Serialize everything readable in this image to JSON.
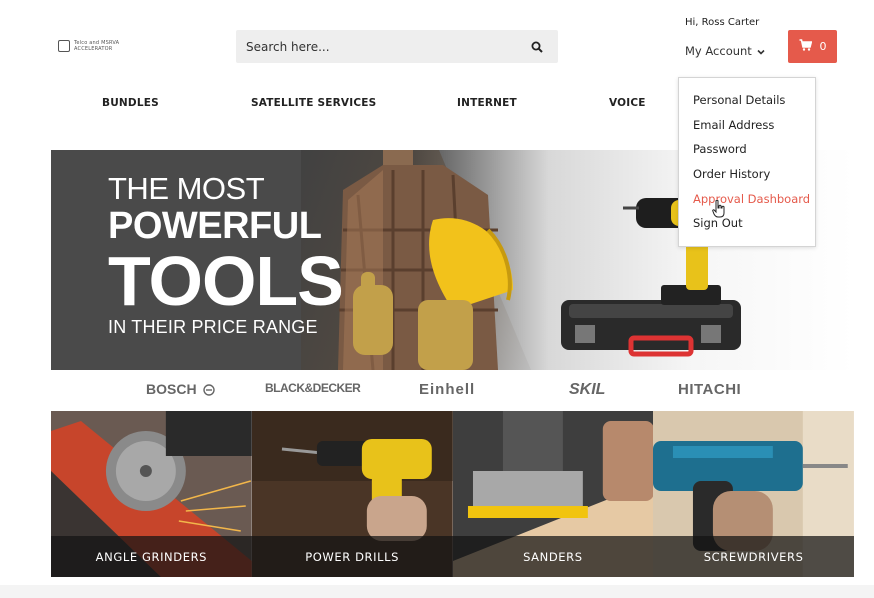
{
  "header": {
    "logo_text": "Telco and MSRVA ACCELERATOR",
    "search_placeholder": "Search here...",
    "greeting": "Hi, Ross Carter",
    "my_account_label": "My Account",
    "cart_count": "0"
  },
  "nav": {
    "items": [
      {
        "label": "BUNDLES"
      },
      {
        "label": "SATELLITE SERVICES"
      },
      {
        "label": "INTERNET"
      },
      {
        "label": "VOICE"
      }
    ]
  },
  "account_menu": {
    "items": [
      {
        "label": "Personal Details"
      },
      {
        "label": "Email Address"
      },
      {
        "label": "Password"
      },
      {
        "label": "Order History"
      },
      {
        "label": "Approval Dashboard",
        "active": true
      },
      {
        "label": "Sign Out"
      }
    ]
  },
  "hero": {
    "line1": "THE MOST",
    "line2": "POWERFUL",
    "line3": "TOOLS",
    "line4": "IN THEIR PRICE RANGE"
  },
  "brands": [
    {
      "name": "BOSCH"
    },
    {
      "name": "BLACK&DECKER"
    },
    {
      "name": "Einhell"
    },
    {
      "name": "SKIL"
    },
    {
      "name": "HITACHI"
    }
  ],
  "categories": [
    {
      "label": "ANGLE GRINDERS"
    },
    {
      "label": "POWER DRILLS"
    },
    {
      "label": "SANDERS"
    },
    {
      "label": "SCREWDRIVERS"
    }
  ],
  "colors": {
    "accent": "#e55a4b",
    "search_bg": "#eeeeee",
    "hero_dark": "#4a4a4a"
  },
  "icons": [
    "search-icon",
    "chevron-down-icon",
    "cart-icon",
    "pointer-cursor-icon"
  ]
}
